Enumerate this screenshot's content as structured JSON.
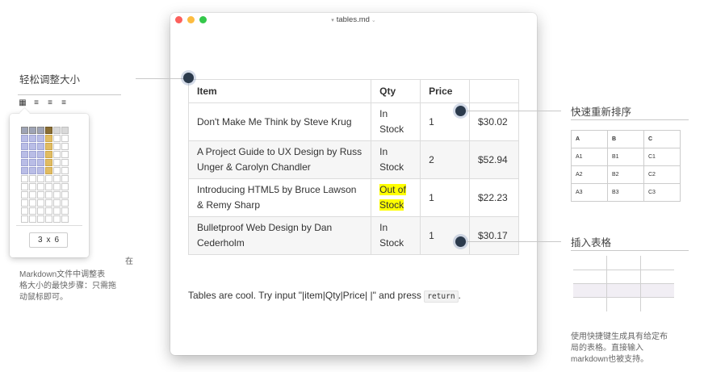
{
  "window": {
    "title": "tables.md",
    "file_icon": "markdown-file-icon",
    "traffic_colors": {
      "close": "#fc605c",
      "minimize": "#fdbc40",
      "zoom": "#34c84a"
    }
  },
  "table": {
    "headers": [
      "Item",
      "Qty",
      "Price",
      ""
    ],
    "rows": [
      {
        "item": "Don't Make Me Think by Steve Krug",
        "stock": "In Stock",
        "qty": "1",
        "price": "$30.02",
        "highlight": false
      },
      {
        "item": "A Project Guide to UX Design by Russ Unger & Carolyn Chandler",
        "stock": "In Stock",
        "qty": "2",
        "price": "$52.94",
        "highlight": false
      },
      {
        "item": "Introducing HTML5 by Bruce Lawson & Remy Sharp",
        "stock": "Out of Stock",
        "qty": "1",
        "price": "$22.23",
        "highlight": true
      },
      {
        "item": "Bulletproof Web Design by Dan Cederholm",
        "stock": "In Stock",
        "qty": "1",
        "price": "$30.17",
        "highlight": false
      }
    ],
    "highlight_color": "#ffff00"
  },
  "footer": {
    "before": "Tables are cool. Try input \"|item|Qty|Price| |\" and press ",
    "key": "return",
    "after": "."
  },
  "left_callout": {
    "title": "轻松调整大小",
    "desc_lead": "在",
    "desc_lines": [
      "Markdown文件中调整表",
      "格大小的最快步骤：只需拖",
      "动鼠标即可。"
    ],
    "toolbar_icons": [
      "table-grid-icon",
      "align-left-icon",
      "align-center-icon",
      "align-right-icon"
    ],
    "toolbar_glyphs": [
      "▦",
      "≡",
      "≡",
      "≡"
    ],
    "size": {
      "cols": "3",
      "x": "x",
      "rows": "6"
    }
  },
  "right_callouts": {
    "reorder_title": "快速重新排序",
    "mini_table": {
      "headers": [
        "A",
        "B",
        "C"
      ],
      "rows": [
        [
          "A1",
          "B1",
          "C1"
        ],
        [
          "A2",
          "B2",
          "C2"
        ],
        [
          "A3",
          "B3",
          "C3"
        ]
      ]
    },
    "insert_title": "插入表格",
    "insert_desc": [
      "使用快捷键生成具有给定布",
      "局的表格。直接输入",
      "markdown也被支持。"
    ]
  },
  "marker_color": "#2b3a4c"
}
